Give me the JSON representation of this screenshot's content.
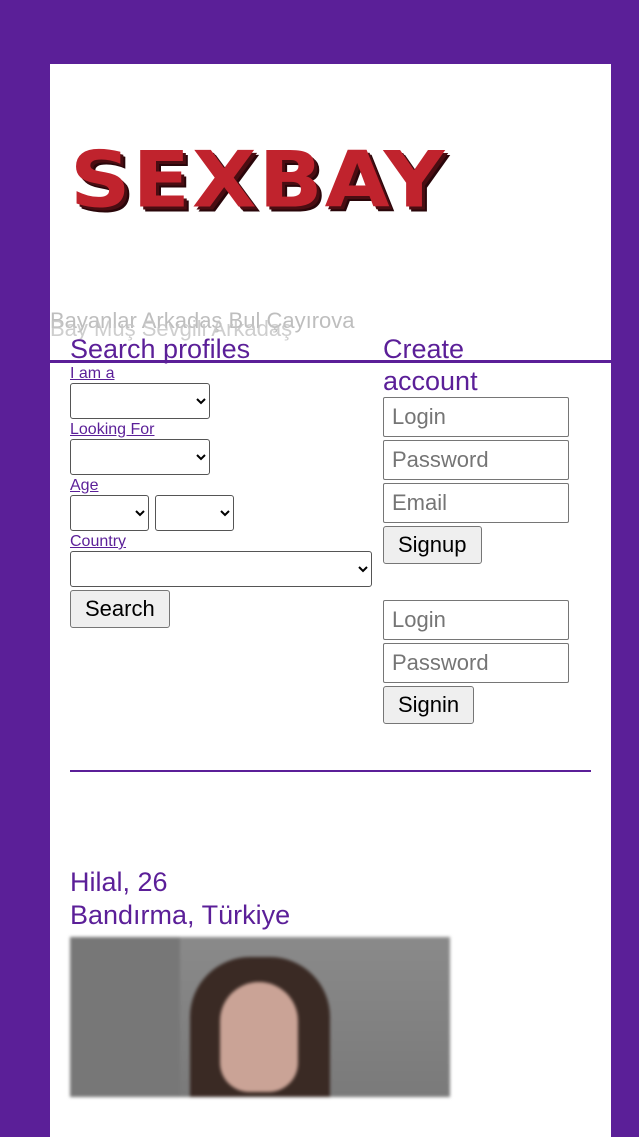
{
  "logo": {
    "text": "SEXBAY"
  },
  "taglines": [
    "Bayanlar Arkadaş Bul Çayırova",
    "Bay Muş Sevgili Arkadaş"
  ],
  "search": {
    "title": "Search profiles",
    "i_am_label": "I am a",
    "looking_for_label": "Looking For",
    "age_label": "Age",
    "country_label": "Country",
    "search_button": "Search"
  },
  "signup": {
    "title": "Create account",
    "login_placeholder": "Login",
    "password_placeholder": "Password",
    "email_placeholder": "Email",
    "signup_button": "Signup"
  },
  "signin": {
    "login_placeholder": "Login",
    "password_placeholder": "Password",
    "signin_button": "Signin"
  },
  "profile": {
    "name_age": "Hilal, 26",
    "location": "Bandırma, Türkiye"
  },
  "colors": {
    "accent": "#5b1f98",
    "logo_red": "#c0232d"
  }
}
